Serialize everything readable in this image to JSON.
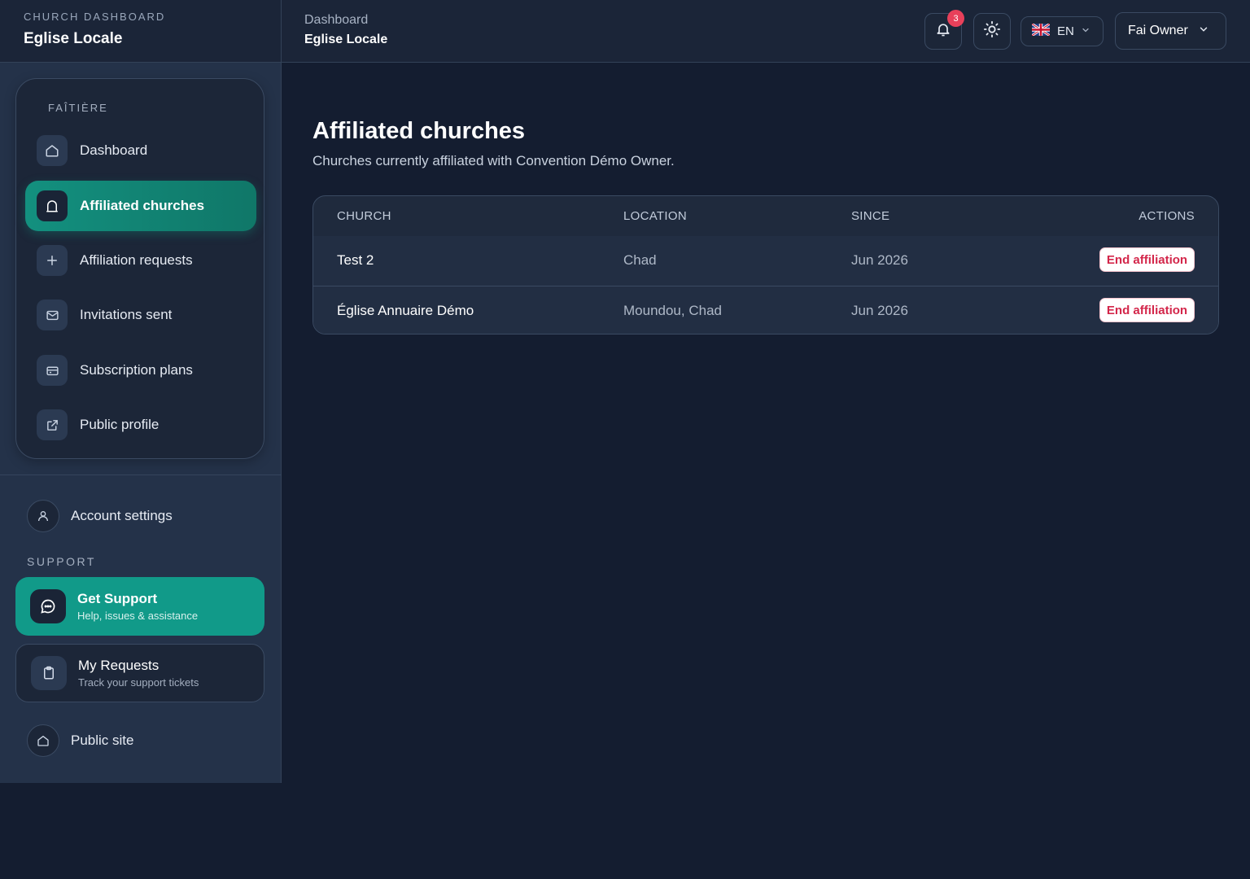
{
  "brand": {
    "kicker": "CHURCH DASHBOARD",
    "name": "Eglise Locale"
  },
  "sidebar": {
    "section_label": "FAÎTIÈRE",
    "items": [
      {
        "label": "Dashboard",
        "icon": "home-icon"
      },
      {
        "label": "Affiliated churches",
        "icon": "church-icon",
        "active": true
      },
      {
        "label": "Affiliation requests",
        "icon": "plus-icon"
      },
      {
        "label": "Invitations sent",
        "icon": "mail-icon"
      },
      {
        "label": "Subscription plans",
        "icon": "credit-card-icon"
      },
      {
        "label": "Public profile",
        "icon": "external-link-icon"
      }
    ],
    "account_settings": "Account settings",
    "support_label": "SUPPORT",
    "get_support": {
      "title": "Get Support",
      "subtitle": "Help, issues & assistance"
    },
    "my_requests": {
      "title": "My Requests",
      "subtitle": "Track your support tickets"
    },
    "public_site": "Public site"
  },
  "header": {
    "breadcrumb_top": "Dashboard",
    "breadcrumb_current": "Eglise Locale",
    "notification_count": "3",
    "language": "EN",
    "user_name": "Fai Owner"
  },
  "main": {
    "title": "Affiliated churches",
    "subtitle": "Churches currently affiliated with Convention Démo Owner.",
    "table": {
      "columns": [
        "CHURCH",
        "LOCATION",
        "SINCE",
        "ACTIONS"
      ],
      "rows": [
        {
          "church": "Test 2",
          "location": "Chad",
          "since": "Jun 2026",
          "action": "End affiliation"
        },
        {
          "church": "Église Annuaire Démo",
          "location": "Moundou, Chad",
          "since": "Jun 2026",
          "action": "End affiliation"
        }
      ]
    }
  },
  "colors": {
    "accent": "#119a89",
    "background": "#141d30",
    "sidebar": "#243249",
    "danger": "#d3264a",
    "badge": "#e8405a"
  }
}
